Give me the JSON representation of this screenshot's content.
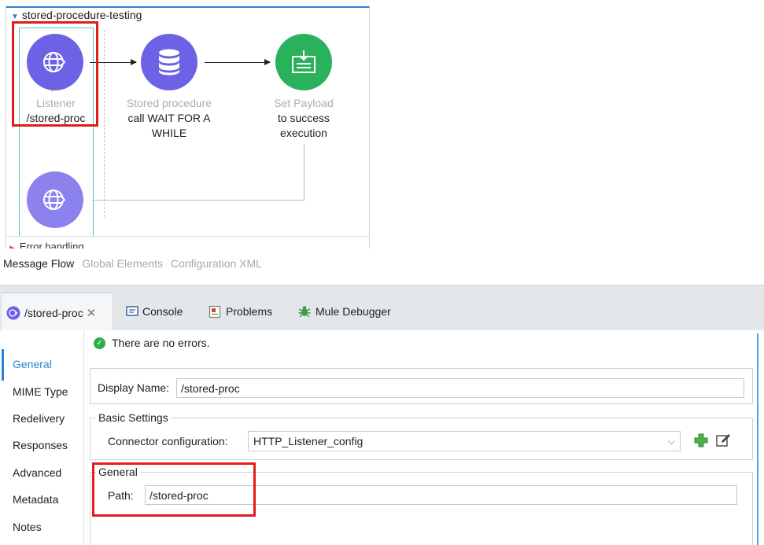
{
  "flow": {
    "title": "stored-procedure-testing",
    "error_handling_label": "Error handling",
    "nodes": [
      {
        "type": "Listener",
        "name": "/stored-proc",
        "icon": "globe-icon"
      },
      {
        "type": "Stored procedure",
        "name": "call WAIT FOR A WHILE",
        "icon": "database-icon"
      },
      {
        "type": "Set Payload",
        "name": "to success execution",
        "icon": "set-payload-icon"
      }
    ]
  },
  "editor_tabs": [
    "Message Flow",
    "Global Elements",
    "Configuration XML"
  ],
  "panel_tabs": {
    "active": "/stored-proc",
    "console": "Console",
    "problems": "Problems",
    "debugger": "Mule Debugger"
  },
  "nav": [
    "General",
    "MIME Type",
    "Redelivery",
    "Responses",
    "Advanced",
    "Metadata",
    "Notes"
  ],
  "status": "There are no errors.",
  "form": {
    "display_name_label": "Display Name:",
    "display_name_value": "/stored-proc",
    "basic_settings_title": "Basic Settings",
    "connector_label": "Connector configuration:",
    "connector_value": "HTTP_Listener_config",
    "general_title": "General",
    "path_label": "Path:",
    "path_value": "/stored-proc"
  },
  "colors": {
    "listener_node": "#6d62e6",
    "payload_node": "#2ab15c",
    "highlight": "#e21b1b",
    "accent": "#2f82d1"
  }
}
